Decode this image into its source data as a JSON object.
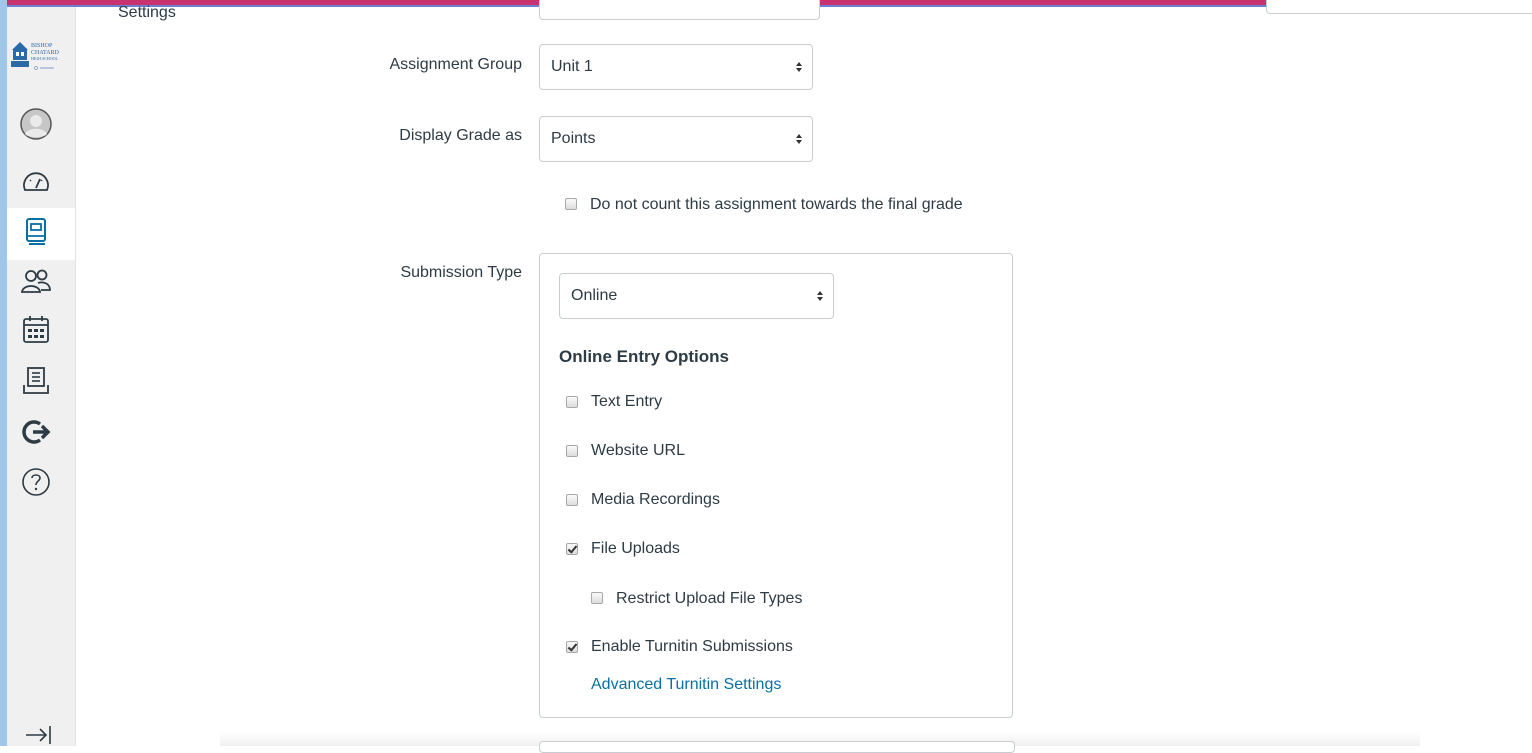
{
  "page": {
    "section_heading": "Settings"
  },
  "nav": {
    "items": [
      {
        "icon": "account-avatar-icon",
        "interactable": true
      },
      {
        "icon": "dashboard-icon",
        "interactable": true
      },
      {
        "icon": "courses-icon",
        "interactable": true,
        "active": true
      },
      {
        "icon": "groups-icon",
        "interactable": true
      },
      {
        "icon": "calendar-icon",
        "interactable": true
      },
      {
        "icon": "inbox-icon",
        "interactable": true
      },
      {
        "icon": "commons-icon",
        "interactable": true
      },
      {
        "icon": "help-icon",
        "interactable": true
      }
    ],
    "collapse_icon": "collapse-nav-icon",
    "logo_lines": [
      "BISHOP",
      "CHATARD",
      "HIGH SCHOOL"
    ]
  },
  "form": {
    "assignment_group": {
      "label": "Assignment Group",
      "value": "Unit 1"
    },
    "display_grade": {
      "label": "Display Grade as",
      "value": "Points"
    },
    "omit_from_final": {
      "label": "Do not count this assignment towards the final grade",
      "checked": false
    },
    "submission_type": {
      "label": "Submission Type",
      "value": "Online",
      "online_entry_heading": "Online Entry Options",
      "options": [
        {
          "label": "Text Entry",
          "checked": false
        },
        {
          "label": "Website URL",
          "checked": false
        },
        {
          "label": "Media Recordings",
          "checked": false
        },
        {
          "label": "File Uploads",
          "checked": true
        },
        {
          "label": "Restrict Upload File Types",
          "checked": false
        },
        {
          "label": "Enable Turnitin Submissions",
          "checked": true
        }
      ],
      "advanced_link": "Advanced Turnitin Settings"
    }
  },
  "colors": {
    "accent_top": "#c8326e",
    "link": "#0770a3",
    "nav_active": "#0770a3",
    "nav_icon": "#2d3b45"
  }
}
